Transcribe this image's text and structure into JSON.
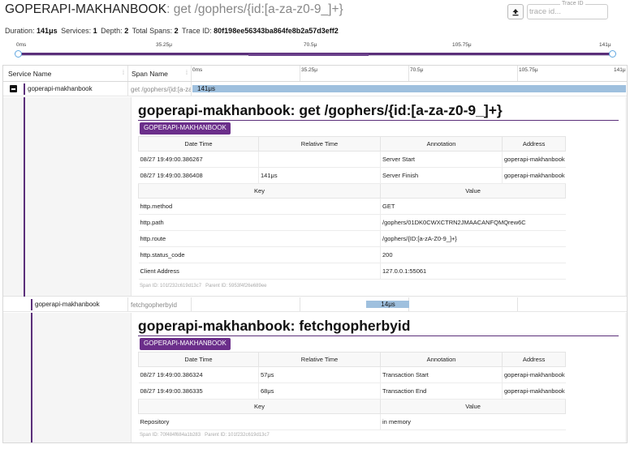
{
  "header": {
    "service_name": "GOPERAPI-MAKHANBOOK",
    "operation": ": get /gophers/{id:[a-za-z0-9_]+}",
    "upload_icon": "upload-icon",
    "trace_id_legend": "Trace ID",
    "trace_id_placeholder": "trace id..."
  },
  "summary": {
    "duration_label": "Duration:",
    "duration_value": "141μs",
    "services_label": "Services:",
    "services_value": "1",
    "depth_label": "Depth:",
    "depth_value": "2",
    "spans_label": "Total Spans:",
    "spans_value": "2",
    "traceid_label": "Trace ID:",
    "traceid_value": "80f198ee56343ba864fe8b2a57d3eff2"
  },
  "minimap": {
    "ticks": [
      "0ms",
      "35.25μ",
      "70.5μ",
      "105.75μ",
      "141μ"
    ]
  },
  "table": {
    "col_service": "Service Name",
    "col_span": "Span Name",
    "ticks": [
      "0ms",
      "35.25μ",
      "70.5μ",
      "105.75μ",
      "141μ"
    ]
  },
  "spans": [
    {
      "service": "goperapi-makhanbook",
      "span_name": "get /gophers/{id:[a-za-z0-9_]+}",
      "duration": "141μs",
      "bar_start": 0.0,
      "bar_fraction": 1.0,
      "detail": {
        "title": "goperapi-makhanbook: get /gophers/{id:[a-za-z0-9_]+}",
        "badge": "GOPERAPI-MAKHANBOOK",
        "annotation_headers": [
          "Date Time",
          "Relative Time",
          "Annotation",
          "Address"
        ],
        "annotations": [
          {
            "datetime": "08/27 19:49:00.386267",
            "relative": "",
            "annotation": "Server Start",
            "address": "goperapi-makhanbook"
          },
          {
            "datetime": "08/27 19:49:00.386408",
            "relative": "141μs",
            "annotation": "Server Finish",
            "address": "goperapi-makhanbook"
          }
        ],
        "tag_headers": [
          "Key",
          "Value"
        ],
        "tags": [
          {
            "key": "http.method",
            "value": "GET"
          },
          {
            "key": "http.path",
            "value": "/gophers/01DK0CWXCTRN2JMAACANFQMQrew6C"
          },
          {
            "key": "http.route",
            "value": "/gophers/{ID:[a-zA-Z0-9_]+}"
          },
          {
            "key": "http.status_code",
            "value": "200"
          },
          {
            "key": "Client Address",
            "value": "127.0.0.1:55061"
          }
        ],
        "span_id_label": "Span ID:",
        "span_id": "101f232c619d13c7",
        "parent_id_label": "Parent ID:",
        "parent_id": "5953f4f26e689ee"
      }
    },
    {
      "service": "goperapi-makhanbook",
      "span_name": "fetchgopherbyid",
      "duration": "14μs",
      "bar_start": 0.4,
      "bar_fraction": 0.1,
      "detail": {
        "title": "goperapi-makhanbook: fetchgopherbyid",
        "badge": "GOPERAPI-MAKHANBOOK",
        "annotation_headers": [
          "Date Time",
          "Relative Time",
          "Annotation",
          "Address"
        ],
        "annotations": [
          {
            "datetime": "08/27 19:49:00.386324",
            "relative": "57μs",
            "annotation": "Transaction Start",
            "address": "goperapi-makhanbook"
          },
          {
            "datetime": "08/27 19:49:00.386335",
            "relative": "68μs",
            "annotation": "Transaction End",
            "address": "goperapi-makhanbook"
          }
        ],
        "tag_headers": [
          "Key",
          "Value"
        ],
        "tags": [
          {
            "key": "Repository",
            "value": "in memory"
          }
        ],
        "span_id_label": "Span ID:",
        "span_id": "70f484f684a1b283",
        "parent_id_label": "Parent ID:",
        "parent_id": "101f232c619d13c7"
      }
    }
  ]
}
